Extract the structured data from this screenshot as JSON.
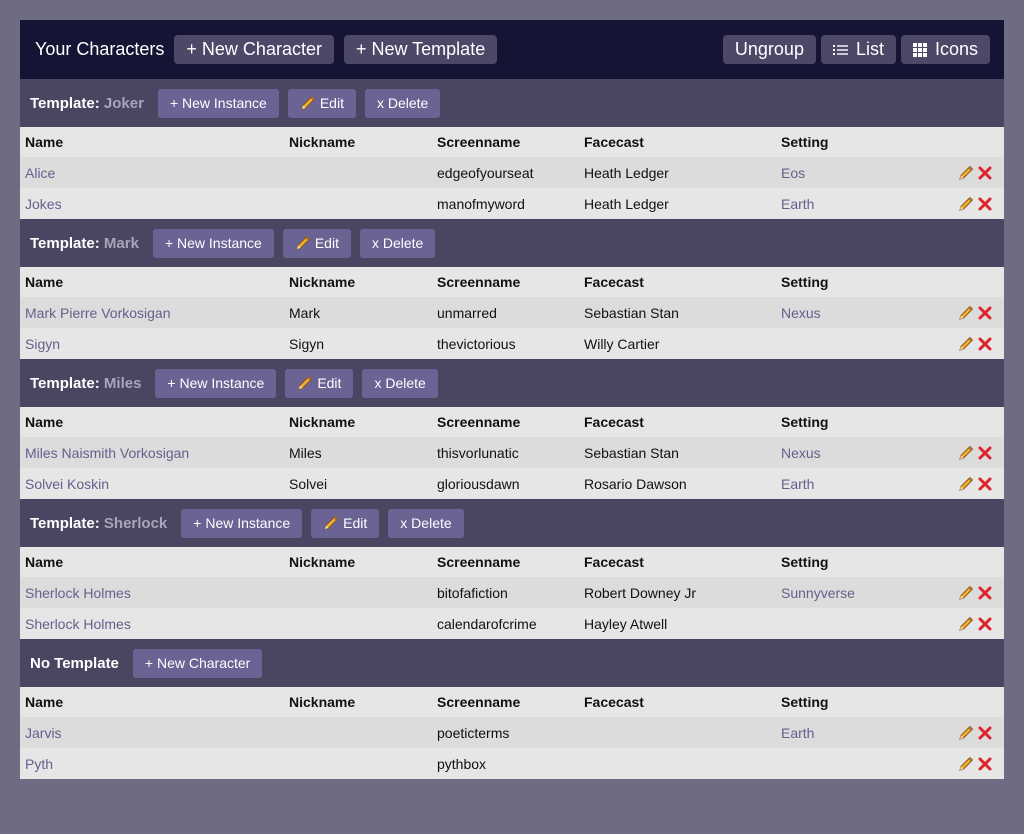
{
  "header": {
    "title": "Your Characters",
    "new_character": "+ New Character",
    "new_template": "+ New Template",
    "ungroup": "Ungroup",
    "list": "List",
    "icons": "Icons"
  },
  "columns": [
    "Name",
    "Nickname",
    "Screenname",
    "Facecast",
    "Setting"
  ],
  "groups": [
    {
      "prefix": "Template:",
      "name": "Joker",
      "buttons": {
        "new": "+ New Instance",
        "edit": "Edit",
        "delete": "x Delete"
      },
      "rows": [
        {
          "name": "Alice",
          "nickname": "",
          "screenname": "edgeofyourseat",
          "facecast": "Heath Ledger",
          "setting": "Eos"
        },
        {
          "name": "Jokes",
          "nickname": "",
          "screenname": "manofmyword",
          "facecast": "Heath Ledger",
          "setting": "Earth"
        }
      ]
    },
    {
      "prefix": "Template:",
      "name": "Mark",
      "buttons": {
        "new": "+ New Instance",
        "edit": "Edit",
        "delete": "x Delete"
      },
      "rows": [
        {
          "name": "Mark Pierre Vorkosigan",
          "nickname": "Mark",
          "screenname": "unmarred",
          "facecast": "Sebastian Stan",
          "setting": "Nexus"
        },
        {
          "name": "Sigyn",
          "nickname": "Sigyn",
          "screenname": "thevictorious",
          "facecast": "Willy Cartier",
          "setting": ""
        }
      ]
    },
    {
      "prefix": "Template:",
      "name": "Miles",
      "buttons": {
        "new": "+ New Instance",
        "edit": "Edit",
        "delete": "x Delete"
      },
      "rows": [
        {
          "name": "Miles Naismith Vorkosigan",
          "nickname": "Miles",
          "screenname": "thisvorlunatic",
          "facecast": "Sebastian Stan",
          "setting": "Nexus"
        },
        {
          "name": "Solvei Koskin",
          "nickname": "Solvei",
          "screenname": "gloriousdawn",
          "facecast": "Rosario Dawson",
          "setting": "Earth"
        }
      ]
    },
    {
      "prefix": "Template:",
      "name": "Sherlock",
      "buttons": {
        "new": "+ New Instance",
        "edit": "Edit",
        "delete": "x Delete"
      },
      "rows": [
        {
          "name": "Sherlock Holmes",
          "nickname": "",
          "screenname": "bitofafiction",
          "facecast": "Robert Downey Jr",
          "setting": "Sunnyverse"
        },
        {
          "name": "Sherlock Holmes",
          "nickname": "",
          "screenname": "calendarofcrime",
          "facecast": "Hayley Atwell",
          "setting": ""
        }
      ]
    },
    {
      "prefix": "No Template",
      "name": "",
      "buttons": {
        "new": "+ New Character"
      },
      "rows": [
        {
          "name": "Jarvis",
          "nickname": "",
          "screenname": "poeticterms",
          "facecast": "",
          "setting": "Earth"
        },
        {
          "name": "Pyth",
          "nickname": "",
          "screenname": "pythbox",
          "facecast": "",
          "setting": ""
        }
      ]
    }
  ],
  "colors": {
    "page_bg": "#6e6c82",
    "topbar_bg": "#161435",
    "group_header_bg": "#4a4661",
    "button_bg": "#6a6394",
    "link": "#645f8c",
    "delete_icon": "#e0222b",
    "edit_icon": "#f2b134"
  },
  "icons": {
    "edit": "pencil-icon",
    "delete": "delete-x-icon",
    "list": "list-icon",
    "icons": "grid-icon"
  }
}
